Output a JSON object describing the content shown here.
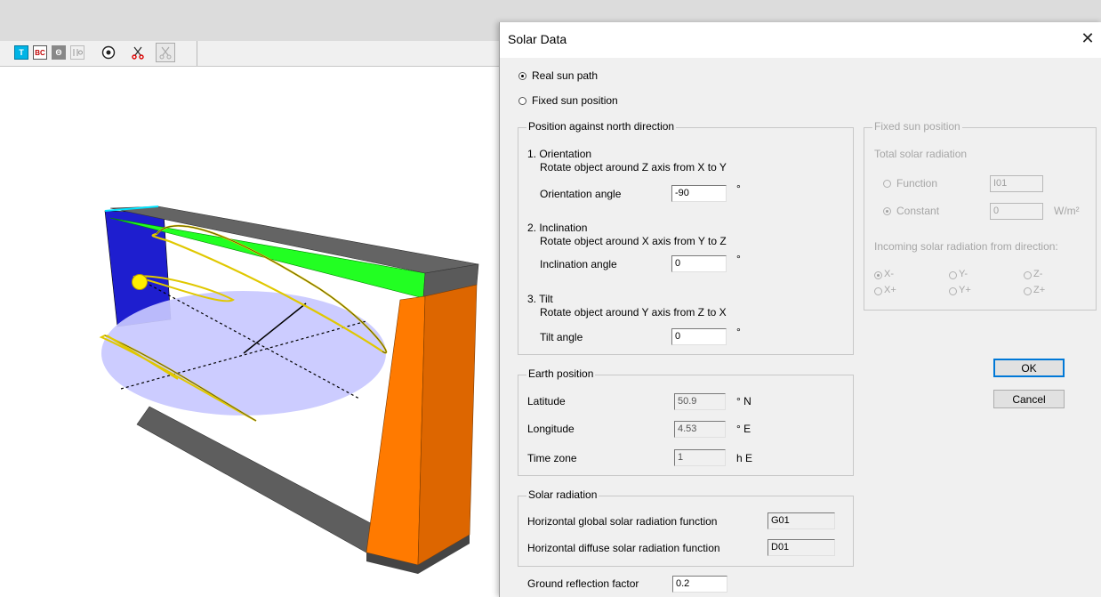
{
  "dialog": {
    "title": "Solar Data",
    "close": "✕",
    "mode": {
      "real_sun_path": "Real sun path",
      "fixed_sun_position": "Fixed sun position",
      "selected": "real_sun_path"
    },
    "north": {
      "title": "Position against north direction",
      "orientation_header": "1. Orientation",
      "orientation_desc": "Rotate object around Z axis from X to Y",
      "orientation_label": "Orientation angle",
      "orientation_value": "-90",
      "inclination_header": "2. Inclination",
      "inclination_desc": "Rotate object around X axis from Y to Z",
      "inclination_label": "Inclination angle",
      "inclination_value": "0",
      "tilt_header": "3. Tilt",
      "tilt_desc": "Rotate object around Y axis from Z to X",
      "tilt_label": "Tilt angle",
      "tilt_value": "0",
      "degree": "°"
    },
    "fixed": {
      "title": "Fixed sun position",
      "total_label": "Total solar radiation",
      "function_label": "Function",
      "function_value": "I01",
      "constant_label": "Constant",
      "constant_value": "0",
      "unit": "W/m²",
      "direction_label": "Incoming solar radiation from direction:",
      "directions": [
        "X-",
        "Y-",
        "Z-",
        "X+",
        "Y+",
        "Z+"
      ],
      "selected_direction": "X-"
    },
    "earth": {
      "title": "Earth position",
      "latitude_label": "Latitude",
      "latitude_value": "50.9",
      "latitude_unit": "° N",
      "longitude_label": "Longitude",
      "longitude_value": "4.53",
      "longitude_unit": "° E",
      "timezone_label": "Time zone",
      "timezone_value": "1",
      "timezone_unit": "h E"
    },
    "radiation": {
      "title": "Solar radiation",
      "global_label": "Horizontal global solar radiation function",
      "global_value": "G01",
      "diffuse_label": "Horizontal diffuse solar radiation function",
      "diffuse_value": "D01"
    },
    "ground": {
      "label": "Ground reflection factor",
      "value": "0.2"
    },
    "ok": "OK",
    "cancel": "Cancel"
  },
  "toolbar": {
    "t_label": "T",
    "bc_label": "BC",
    "theta_label": "Θ"
  },
  "colors": {
    "accent": "#0078d7",
    "green": "#00ff00",
    "orange": "#ff7f00",
    "blue": "#1414c8",
    "gray": "#6a6a6a"
  }
}
